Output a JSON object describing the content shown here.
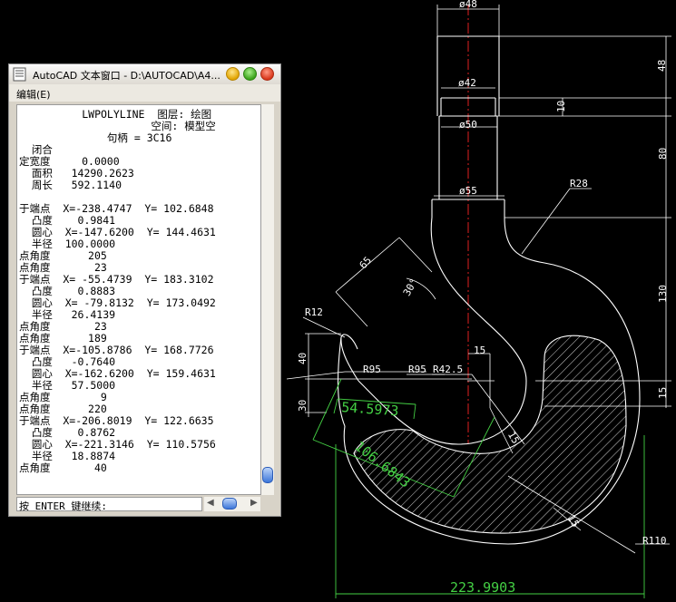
{
  "window": {
    "title": "AutoCAD 文本窗口 - D:\\AUTOCAD\\A4...",
    "menu_edit": "编辑(E)",
    "command_prompt": "按 ENTER 键继续:",
    "lines": [
      "          LWPOLYLINE  图层: 绘图",
      "                     空间: 模型空",
      "              句柄 = 3C16",
      "  闭合",
      "定宽度     0.0000",
      "  面积   14290.2623",
      "  周长   592.1140",
      "",
      "于端点  X=-238.4747  Y= 102.6848",
      "  凸度    0.9841",
      "  圆心  X=-147.6200  Y= 144.4631",
      "  半径  100.0000",
      "点角度      205",
      "点角度       23",
      "于端点  X= -55.4739  Y= 183.3102",
      "  凸度    0.8883",
      "  圆心  X= -79.8132  Y= 173.0492",
      "  半径   26.4139",
      "点角度       23",
      "点角度      189",
      "于端点  X=-105.8786  Y= 168.7726",
      "  凸度   -0.7640",
      "  圆心  X=-162.6200  Y= 159.4631",
      "  半径   57.5000",
      "点角度        9",
      "点角度      220",
      "于端点  X=-206.8019  Y= 122.6635",
      "  凸度    0.8762",
      "  圆心  X=-221.3146  Y= 110.5756",
      "  半径   18.8874",
      "点角度       40"
    ]
  },
  "drawing": {
    "dia_48": "ø48",
    "dia_42": "ø42",
    "dia_50": "ø50",
    "dia_55": "ø55",
    "dim_48": "48",
    "dim_10": "10",
    "dim_80": "80",
    "dim_130": "130",
    "dim_15_right": "15",
    "dim_15_center": "15",
    "dim_15_diag": "15",
    "dim_15_arc": "15",
    "dim_40": "40",
    "dim_30": "30",
    "dim_65": "65",
    "angle_30": "30°",
    "r28": "R28",
    "r12": "R12",
    "r95_a": "R95",
    "r95_b": "R95",
    "r42_5": "R42.5",
    "r110": "R110",
    "green_54": "54.5973",
    "green_106": "106.6843",
    "green_224": "223.9903"
  }
}
